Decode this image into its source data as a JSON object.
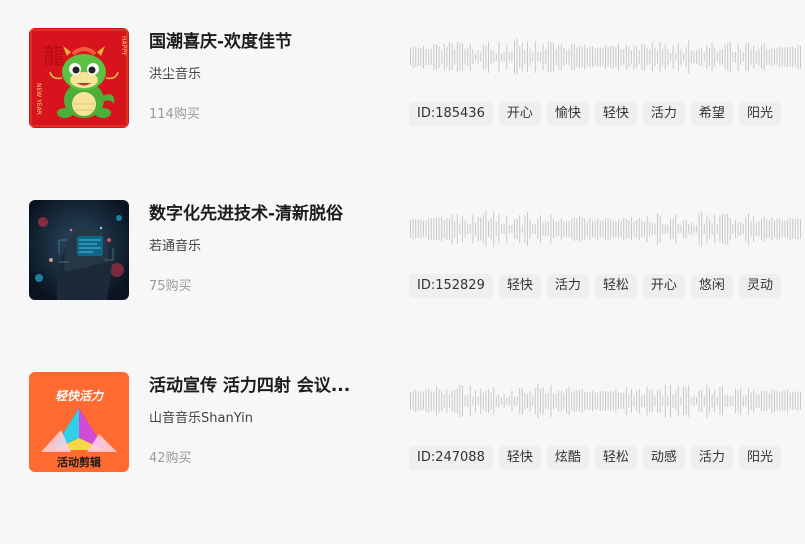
{
  "tracks": [
    {
      "title": "国潮喜庆-欢度佳节",
      "artist": "洪尘音乐",
      "purchases": "114购买",
      "id_tag": "ID:185436",
      "tags": [
        "开心",
        "愉快",
        "轻快",
        "活力",
        "希望",
        "阳光"
      ],
      "cover": {
        "theme": "red-dragon-new-year",
        "side_text_left": "NEW YEAR",
        "side_text_right": "HAPPY",
        "glyph": "龍",
        "bg_color": "#d7141e"
      }
    },
    {
      "title": "数字化先进技术-清新脱俗",
      "artist": "若通音乐",
      "purchases": "75购买",
      "id_tag": "ID:152829",
      "tags": [
        "轻快",
        "活力",
        "轻松",
        "开心",
        "悠闲",
        "灵动"
      ],
      "cover": {
        "theme": "cyber-head-hud",
        "bg_color": "#0e1d2c"
      }
    },
    {
      "title": "活动宣传 活力四射 会议...",
      "artist": "山音音乐ShanYin",
      "purchases": "42购买",
      "id_tag": "ID:247088",
      "tags": [
        "轻快",
        "炫酷",
        "轻松",
        "动感",
        "活力",
        "阳光"
      ],
      "cover": {
        "theme": "colorful-triangle",
        "text_top": "轻快活力",
        "text_bottom": "活动剪辑",
        "bg_color": "#ff6a30"
      }
    }
  ]
}
